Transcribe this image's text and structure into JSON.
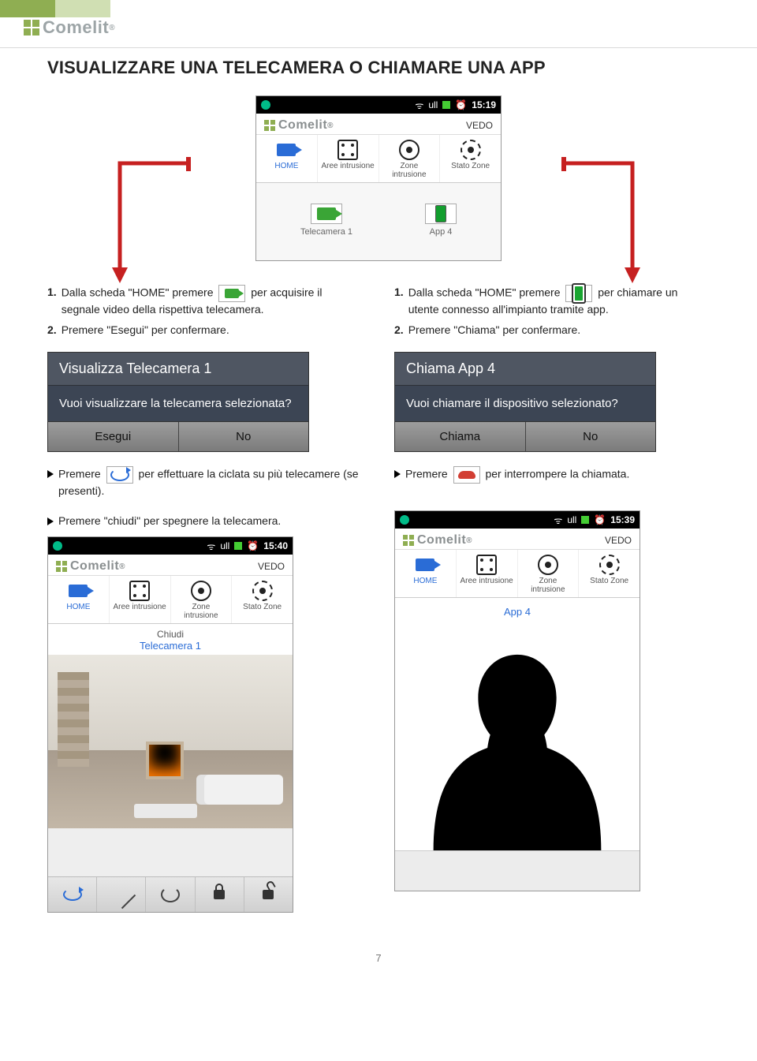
{
  "page_number": "7",
  "brand": "Comelit",
  "section_title": "VISUALIZZARE UNA TELECAMERA O CHIAMARE UNA APP",
  "top_phone": {
    "status": {
      "time": "15:19",
      "signal": "ull",
      "wifi": "⌵"
    },
    "appbar_right": "VEDO",
    "tabs": {
      "home": "HOME",
      "aree": "Aree intrusione",
      "zone": "Zone intrusione",
      "stato": "Stato Zone"
    },
    "launch1": "Telecamera 1",
    "launch2": "App 4"
  },
  "left": {
    "step1_pre": "Dalla scheda \"HOME\" premere",
    "step1_post": "per acquisire il segnale video della rispettiva telecamera.",
    "step2": "Premere \"Esegui\" per confermare.",
    "dialog": {
      "title": "Visualizza Telecamera 1",
      "body": "Vuoi visualizzare la telecamera selezionata?",
      "ok": "Esegui",
      "no": "No"
    },
    "bullet1_pre": "Premere",
    "bullet1_post": "per effettuare la ciclata su più telecamere (se presenti).",
    "bullet2": "Premere \"chiudi\" per spegnere la telecamera.",
    "phone2": {
      "status_time": "15:40",
      "appbar_right": "VEDO",
      "chiudi": "Chiudi",
      "caption": "Telecamera 1"
    }
  },
  "right": {
    "step1_pre": "Dalla scheda \"HOME\" premere",
    "step1_post": "per chiamare un utente connesso all'impianto tramite app.",
    "step2": "Premere \"Chiama\" per confermare.",
    "dialog": {
      "title": "Chiama App 4",
      "body": "Vuoi chiamare il dispositivo selezionato?",
      "ok": "Chiama",
      "no": "No"
    },
    "bullet1_pre": "Premere",
    "bullet1_post": "per interrompere la chiamata.",
    "phone2": {
      "status_time": "15:39",
      "appbar_right": "VEDO",
      "caption": "App 4"
    }
  }
}
